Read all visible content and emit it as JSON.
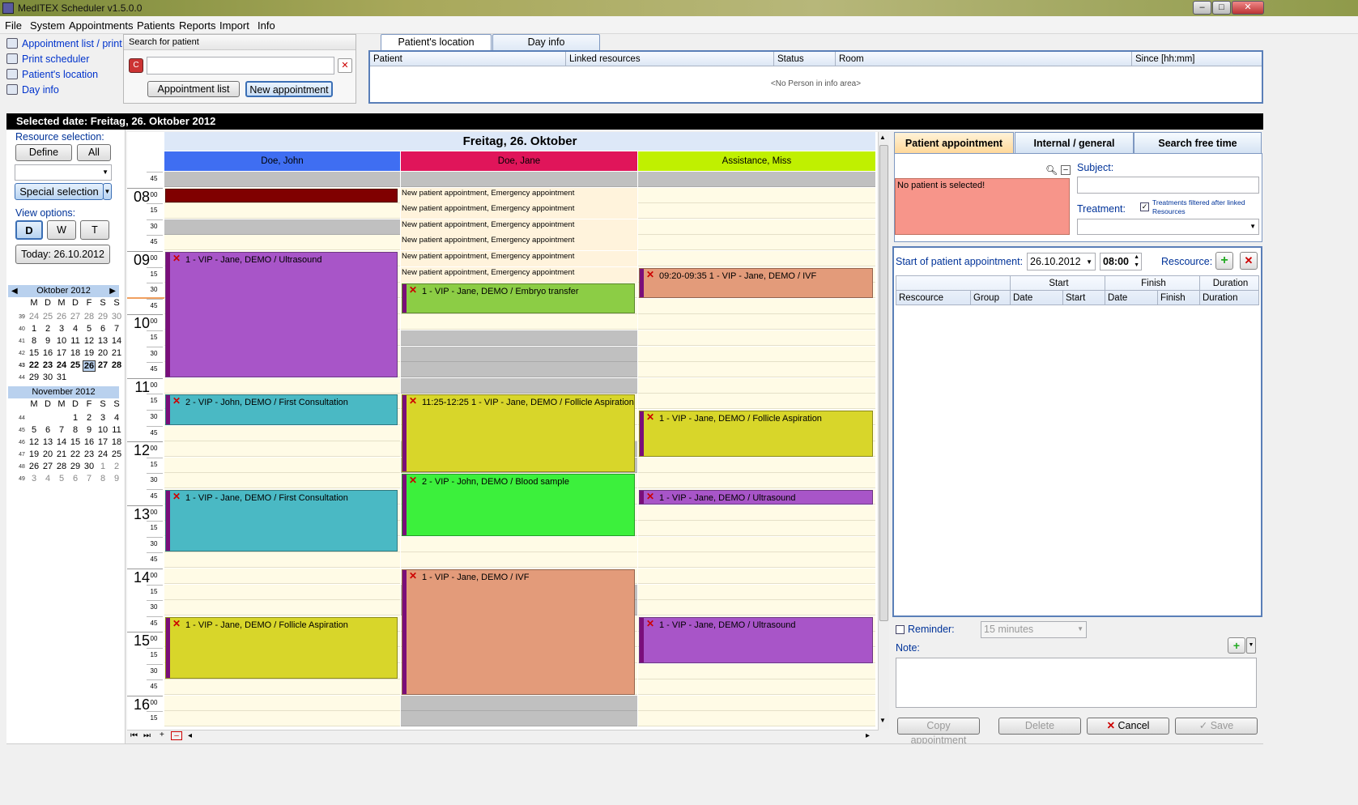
{
  "window": {
    "title": "MedITEX Scheduler v1.5.0.0"
  },
  "menu": [
    "File",
    "System",
    "Appointments",
    "Patients",
    "Reports",
    "Import",
    "Info"
  ],
  "nav": [
    {
      "label": "Appointment list / print",
      "icon": "list-icon"
    },
    {
      "label": "Print scheduler",
      "icon": "printer-icon"
    },
    {
      "label": "Patient's location",
      "icon": "location-icon"
    },
    {
      "label": "Day info",
      "icon": "info-icon"
    }
  ],
  "search": {
    "title": "Search for patient",
    "value": "",
    "appointment_list": "Appointment list",
    "new_appointment": "New appointment"
  },
  "info_tabs": [
    "Patient's location",
    "Day info"
  ],
  "info_columns": [
    "Patient",
    "Linked resources",
    "Status",
    "Room",
    "Since [hh:mm]"
  ],
  "info_empty": "<No Person in info area>",
  "selected_date": "Selected date: Freitag, 26. Oktober 2012",
  "left": {
    "resource_label": "Resource selection:",
    "define": "Define",
    "all": "All",
    "special": "Special selection",
    "view_label": "View options:",
    "views": [
      "D",
      "W",
      "T"
    ],
    "today": "Today: 26.10.2012"
  },
  "calendars": [
    {
      "month": "Oktober 2012",
      "weekdays": [
        "M",
        "D",
        "M",
        "D",
        "F",
        "S",
        "S"
      ],
      "weeks": [
        {
          "wk": "39",
          "days": [
            "24",
            "25",
            "26",
            "27",
            "28",
            "29",
            "30"
          ],
          "muted": [
            1,
            1,
            1,
            1,
            1,
            1,
            1
          ]
        },
        {
          "wk": "40",
          "days": [
            "1",
            "2",
            "3",
            "4",
            "5",
            "6",
            "7"
          ],
          "muted": [
            0,
            0,
            0,
            0,
            0,
            0,
            0
          ]
        },
        {
          "wk": "41",
          "days": [
            "8",
            "9",
            "10",
            "11",
            "12",
            "13",
            "14"
          ],
          "muted": [
            0,
            0,
            0,
            0,
            0,
            0,
            0
          ]
        },
        {
          "wk": "42",
          "days": [
            "15",
            "16",
            "17",
            "18",
            "19",
            "20",
            "21"
          ],
          "muted": [
            0,
            0,
            0,
            0,
            0,
            0,
            0
          ]
        },
        {
          "wk": "43",
          "days": [
            "22",
            "23",
            "24",
            "25",
            "26",
            "27",
            "28"
          ],
          "muted": [
            0,
            0,
            0,
            0,
            0,
            0,
            0
          ],
          "bold": true
        },
        {
          "wk": "44",
          "days": [
            "29",
            "30",
            "31",
            "",
            "",
            "",
            ""
          ],
          "muted": [
            0,
            0,
            0,
            0,
            0,
            0,
            0
          ]
        }
      ],
      "selected": "26"
    },
    {
      "month": "November 2012",
      "weekdays": [
        "M",
        "D",
        "M",
        "D",
        "F",
        "S",
        "S"
      ],
      "weeks": [
        {
          "wk": "44",
          "days": [
            "",
            "",
            "",
            "1",
            "2",
            "3",
            "4"
          ],
          "muted": [
            0,
            0,
            0,
            0,
            0,
            0,
            0
          ]
        },
        {
          "wk": "45",
          "days": [
            "5",
            "6",
            "7",
            "8",
            "9",
            "10",
            "11"
          ],
          "muted": [
            0,
            0,
            0,
            0,
            0,
            0,
            0
          ]
        },
        {
          "wk": "46",
          "days": [
            "12",
            "13",
            "14",
            "15",
            "16",
            "17",
            "18"
          ],
          "muted": [
            0,
            0,
            0,
            0,
            0,
            0,
            0
          ]
        },
        {
          "wk": "47",
          "days": [
            "19",
            "20",
            "21",
            "22",
            "23",
            "24",
            "25"
          ],
          "muted": [
            0,
            0,
            0,
            0,
            0,
            0,
            0
          ]
        },
        {
          "wk": "48",
          "days": [
            "26",
            "27",
            "28",
            "29",
            "30",
            "1",
            "2"
          ],
          "muted": [
            0,
            0,
            0,
            0,
            0,
            1,
            1
          ]
        },
        {
          "wk": "49",
          "days": [
            "3",
            "4",
            "5",
            "6",
            "7",
            "8",
            "9"
          ],
          "muted": [
            1,
            1,
            1,
            1,
            1,
            1,
            1
          ]
        }
      ]
    }
  ],
  "schedule": {
    "day_title": "Freitag, 26. Oktober",
    "resources": [
      {
        "name": "Doe, John",
        "color": "#3f6ef2"
      },
      {
        "name": "Doe, Jane",
        "color": "#e0155a"
      },
      {
        "name": "Assistance, Miss",
        "color": "#c0f000"
      }
    ],
    "times": [
      {
        "h": "",
        "m": "45"
      },
      {
        "h": "08",
        "m": "00"
      },
      {
        "h": "",
        "m": "15"
      },
      {
        "h": "",
        "m": "30"
      },
      {
        "h": "",
        "m": "45"
      },
      {
        "h": "09",
        "m": "00"
      },
      {
        "h": "",
        "m": "15"
      },
      {
        "h": "",
        "m": "30"
      },
      {
        "h": "",
        "m": "45"
      },
      {
        "h": "10",
        "m": "00"
      },
      {
        "h": "",
        "m": "15"
      },
      {
        "h": "",
        "m": "30"
      },
      {
        "h": "",
        "m": "45"
      },
      {
        "h": "11",
        "m": "00"
      },
      {
        "h": "",
        "m": "15"
      },
      {
        "h": "",
        "m": "30"
      },
      {
        "h": "",
        "m": "45"
      },
      {
        "h": "12",
        "m": "00"
      },
      {
        "h": "",
        "m": "15"
      },
      {
        "h": "",
        "m": "30"
      },
      {
        "h": "",
        "m": "45"
      },
      {
        "h": "13",
        "m": "00"
      },
      {
        "h": "",
        "m": "15"
      },
      {
        "h": "",
        "m": "30"
      },
      {
        "h": "",
        "m": "45"
      },
      {
        "h": "14",
        "m": "00"
      },
      {
        "h": "",
        "m": "15"
      },
      {
        "h": "",
        "m": "30"
      },
      {
        "h": "",
        "m": "45"
      },
      {
        "h": "15",
        "m": "00"
      },
      {
        "h": "",
        "m": "15"
      },
      {
        "h": "",
        "m": "30"
      },
      {
        "h": "",
        "m": "45"
      },
      {
        "h": "16",
        "m": "00"
      },
      {
        "h": "",
        "m": "15"
      }
    ],
    "grey_slots": {
      "0": [
        0,
        3
      ],
      "1": [
        0,
        10,
        11,
        12,
        13,
        17,
        18,
        26,
        27,
        33,
        34
      ],
      "2": [
        0
      ]
    },
    "emergency_note": "New patient appointment, Emergency appointment",
    "emergency_rows": [
      1,
      2,
      3,
      4,
      5,
      6
    ],
    "appointments": [
      {
        "col": 0,
        "start": 1,
        "slots": 1,
        "color": "#800000",
        "label": "",
        "plain": true
      },
      {
        "col": 0,
        "start": 5,
        "slots": 8,
        "color": "#a855c8",
        "label": "1 - VIP - Jane, DEMO / Ultrasound"
      },
      {
        "col": 0,
        "start": 14,
        "slots": 2,
        "color": "#4ab9c4",
        "label": "2 - VIP - John, DEMO / First Consultation"
      },
      {
        "col": 0,
        "start": 20,
        "slots": 4,
        "color": "#4ab9c4",
        "label": "1 - VIP - Jane, DEMO / First Consultation"
      },
      {
        "col": 0,
        "start": 28,
        "slots": 4,
        "color": "#d8d62a",
        "label": "1 - VIP - Jane, DEMO / Follicle Aspiration"
      },
      {
        "col": 1,
        "start": 7,
        "slots": 2,
        "color": "#8ccd45",
        "label": "1 - VIP - Jane, DEMO / Embryo transfer"
      },
      {
        "col": 1,
        "start": 14,
        "slots": 5,
        "color": "#d8d62a",
        "label": "11:25-12:25 1 - VIP - Jane, DEMO / Follicle Aspiration"
      },
      {
        "col": 1,
        "start": 19,
        "slots": 4,
        "color": "#3cf03c",
        "label": "2 - VIP - John, DEMO / Blood sample"
      },
      {
        "col": 1,
        "start": 25,
        "slots": 8,
        "color": "#e39b7a",
        "label": "1 - VIP - Jane, DEMO / IVF"
      },
      {
        "col": 2,
        "start": 6,
        "slots": 2,
        "color": "#e39b7a",
        "label": "09:20-09:35 1 - VIP - Jane, DEMO / IVF"
      },
      {
        "col": 2,
        "start": 15,
        "slots": 3,
        "color": "#d8d62a",
        "label": "1 - VIP - Jane, DEMO / Follicle Aspiration"
      },
      {
        "col": 2,
        "start": 20,
        "slots": 1,
        "color": "#a855c8",
        "label": "1 - VIP - Jane, DEMO / Ultrasound"
      },
      {
        "col": 2,
        "start": 28,
        "slots": 3,
        "color": "#a855c8",
        "label": "1 - VIP - Jane, DEMO / Ultrasound"
      }
    ]
  },
  "right": {
    "tabs": [
      "Patient appointment",
      "Internal / general",
      "Search free time"
    ],
    "no_patient": "No patient is selected!",
    "subject_label": "Subject:",
    "treatment_label": "Treatment:",
    "treatments_filter": "Treatments filtered after linked Resources",
    "start_label": "Start of patient appointment:",
    "start_date": "26.10.2012",
    "start_time": "08:00",
    "resource_label": "Rescource:",
    "group_headers": [
      "Start",
      "Finish",
      "Duration"
    ],
    "columns": [
      "Rescource",
      "Group",
      "Date",
      "Start",
      "Date",
      "Finish",
      "Duration"
    ],
    "reminder_label": "Reminder:",
    "reminder_value": "15 minutes",
    "note_label": "Note:",
    "buttons": {
      "copy": "Copy appointment",
      "delete": "Delete",
      "cancel": "Cancel",
      "save": "Save"
    }
  }
}
